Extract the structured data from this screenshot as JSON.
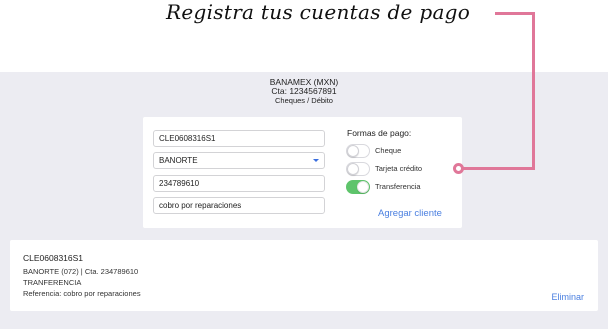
{
  "headline": "Registra tus cuentas de pago",
  "account": {
    "name": "BANAMEX (MXN)",
    "number": "Cta: 1234567891",
    "type": "Cheques / Débito"
  },
  "form": {
    "rfc_value": "CLE0608316S1",
    "bank_value": "BANORTE",
    "account_value": "234789610",
    "reference_value": "cobro por reparaciones"
  },
  "payment": {
    "title": "Formas de pago:",
    "options": [
      {
        "label": "Cheque",
        "enabled": false
      },
      {
        "label": "Tarjeta crédito",
        "enabled": false
      },
      {
        "label": "Transferencia",
        "enabled": true
      }
    ]
  },
  "add_client_label": "Agregar cliente",
  "result": {
    "id": "CLE0608316S1",
    "bank_line": "BANORTE (072) | Cta. 234789610",
    "method_line": "TRANFERENCIA",
    "reference_line": "Referencia: cobro por reparaciones",
    "delete_label": "Eliminar"
  },
  "colors": {
    "accent": "#4a7fe0",
    "toggle_on": "#5ec46b",
    "callout": "#e07799",
    "panel_bg": "#ececf2"
  }
}
